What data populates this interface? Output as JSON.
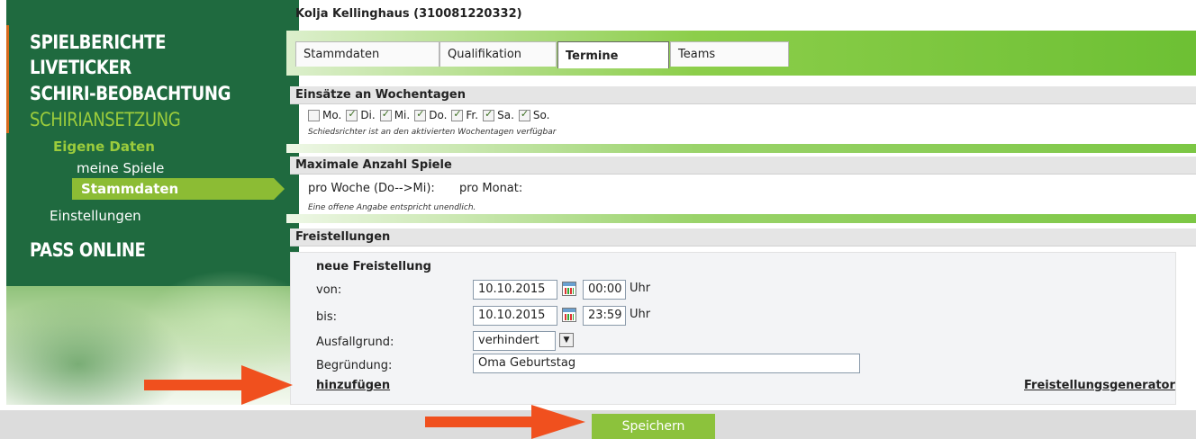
{
  "sidebar": {
    "nav": [
      {
        "label": "SPIELBERICHTE"
      },
      {
        "label": "LIVETICKER"
      },
      {
        "label": "SCHIRI-BEOBACHTUNG"
      },
      {
        "label": "SCHIRIANSETZUNG"
      }
    ],
    "eigene_daten": "Eigene Daten",
    "meine_spiele": "meine Spiele",
    "stammdaten": "Stammdaten",
    "einstellungen": "Einstellungen",
    "pass_online": "PASS ONLINE"
  },
  "header": {
    "user": "Kolja Kellinghaus (310081220332)"
  },
  "tabs": [
    {
      "label": "Stammdaten"
    },
    {
      "label": "Qualifikation"
    },
    {
      "label": "Termine",
      "active": true
    },
    {
      "label": "Teams"
    }
  ],
  "einsaetze": {
    "title": "Einsätze an Wochentagen",
    "days": [
      {
        "label": "Mo.",
        "checked": false
      },
      {
        "label": "Di.",
        "checked": true
      },
      {
        "label": "Mi.",
        "checked": true
      },
      {
        "label": "Do.",
        "checked": true
      },
      {
        "label": "Fr.",
        "checked": true
      },
      {
        "label": "Sa.",
        "checked": true
      },
      {
        "label": "So.",
        "checked": true
      }
    ],
    "note": "Schiedsrichter ist an den aktivierten Wochentagen verfügbar"
  },
  "max_spiele": {
    "title": "Maximale Anzahl Spiele",
    "pro_woche": "pro Woche (Do-->Mi):",
    "pro_monat": "pro Monat:",
    "note": "Eine offene Angabe entspricht unendlich."
  },
  "freistellungen": {
    "title": "Freistellungen",
    "neue": "neue Freistellung",
    "von_label": "von:",
    "von_date": "10.10.2015",
    "von_time": "00:00",
    "bis_label": "bis:",
    "bis_date": "10.10.2015",
    "bis_time": "23:59",
    "uhr": "Uhr",
    "ausfallgrund_label": "Ausfallgrund:",
    "ausfallgrund_value": "verhindert",
    "begruendung_label": "Begründung:",
    "begruendung_value": "Oma Geburtstag",
    "hinzufuegen": "hinzufügen",
    "generator": "Freistellungsgenerator"
  },
  "footer": {
    "save": "Speichern"
  },
  "colors": {
    "sidebar_green": "#1f6a3f",
    "accent_green": "#8cc23c",
    "arrow_orange": "#f0501e"
  }
}
